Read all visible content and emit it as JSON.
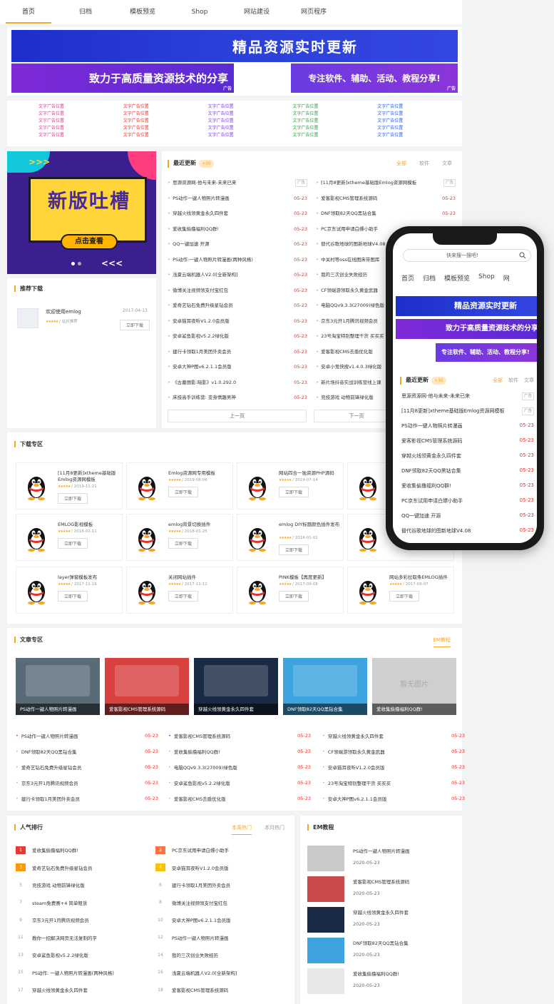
{
  "nav": [
    "首页",
    "归档",
    "模板预览",
    "Shop",
    "网站建设",
    "网页程序"
  ],
  "banners": {
    "b1": "精品资源实时更新",
    "b2": "致力于高质量资源技术的分享",
    "b3": "专注软件、辅助、活动、教程分享!",
    "ad_tag": "广告"
  },
  "text_ads": {
    "label": "文字广告位置",
    "colors": [
      "#e0358f",
      "#e5322d",
      "#7b3fd6",
      "#2ea043",
      "#2b5bd7"
    ]
  },
  "promo": {
    "title": "新版吐槽",
    "cta": "点击查看",
    "arrows_top": ">>>",
    "arrows_bottom": "<<<"
  },
  "recommend": {
    "title": "推荐下载",
    "item": {
      "name": "欢迎使用emlog",
      "date": "2017-04-13",
      "stars": "★★★★★",
      "meta": "/ 站长推荐",
      "button": "立即下载"
    }
  },
  "latest": {
    "title": "最近更新",
    "badge": "+30",
    "tabs": [
      "全部",
      "软件",
      "文章"
    ],
    "left": [
      {
        "t": "思源资源网-他与未来-未来已来",
        "d": "广告",
        "ad": true
      },
      {
        "t": "PS动作一键人物照片转漫画",
        "d": "05-23"
      },
      {
        "t": "穿越火线领黄金永久四件套",
        "d": "05-23"
      },
      {
        "t": "爱收集偷撸福利QQ群!",
        "d": "05-23"
      },
      {
        "t": "QQ一键加速 开源",
        "d": "05-23"
      },
      {
        "t": "PS动作:一键人物照片转漫画(两种风格)",
        "d": "05-23"
      },
      {
        "t": "浅夏云端机器人V2.0[全新架构]",
        "d": "05-23"
      },
      {
        "t": "微博关注视频领支付宝红包",
        "d": "05-23"
      },
      {
        "t": "爱奇艺钻石免费升级星钻会员",
        "d": "05-23"
      },
      {
        "t": "安卓猫耳夜听V1.2.0会员版",
        "d": "05-23"
      },
      {
        "t": "安卓鲨鱼影视v5.2.2绿化版",
        "d": "05-23"
      },
      {
        "t": "建行卡领取1月美团外卖会员",
        "d": "05-23"
      },
      {
        "t": "安卓大神P图v6.2.1.1会员版",
        "d": "05-23"
      },
      {
        "t": "《古墓丽影:暗影》v1.0.292.0",
        "d": "05-23"
      },
      {
        "t": "床技高手训练营: 变身情趣男神",
        "d": "05-23"
      }
    ],
    "right": [
      {
        "t": "[11月8更新]xtheme基础版Emlog资源网模板",
        "d": "广告",
        "ad": true
      },
      {
        "t": "爱客影视CMS管理系统源码",
        "d": "05-23"
      },
      {
        "t": "DNF领取82天QQ黑钻合集",
        "d": "05-23"
      },
      {
        "t": "PC京东试用申请白嫖小助手",
        "d": "05-23"
      },
      {
        "t": "替代谷歌地球的图新地球V4.08",
        "d": "05-23"
      },
      {
        "t": "中关村等oss在线图床带图库",
        "d": "05-23"
      },
      {
        "t": "我的三次创业失败经历",
        "d": "05-23"
      },
      {
        "t": "CF领端游领取永久黄金武器",
        "d": "05-23"
      },
      {
        "t": "电脑QQv9.3.3(27009)绿色版",
        "d": "05-23"
      },
      {
        "t": "京东3元开1月腾讯视频会员",
        "d": "05-23"
      },
      {
        "t": "23号淘宝特别整理干货 买买买",
        "d": "05-23"
      },
      {
        "t": "爱客影视CMS去盾优化版",
        "d": "05-23"
      },
      {
        "t": "安卓小鬼快搜v1.4.0.3绿化版",
        "d": "05-23"
      },
      {
        "t": "新片场抖音实战训练营线上课",
        "d": "05-23"
      },
      {
        "t": "竞技游戏 动物前锋绿化版",
        "d": "05-23"
      }
    ],
    "prev": "上一页",
    "next": "下一页"
  },
  "downloads": {
    "title": "下载专区",
    "items": [
      {
        "name": "[11月8更新]xtheme基础版Emlog资源网模板",
        "meta": "/ 2019-11-21",
        "stars": "★★★★★"
      },
      {
        "name": "Emlog资源网专用模板",
        "meta": "/ 2019-08-06",
        "stars": "★★★★★"
      },
      {
        "name": "网站四合一独资源PHP源码",
        "meta": "/ 2019-07-14",
        "stars": "★★★★★"
      },
      {
        "name": "",
        "meta": "",
        "stars": ""
      },
      {
        "name": "EMLOG影视模板",
        "meta": "/ 2018-02-11",
        "stars": "★★★★★"
      },
      {
        "name": "emlog背景切换插件",
        "meta": "/ 2018-01-25",
        "stars": "★★★★★"
      },
      {
        "name": "emlog DIY标题颜色插件发布",
        "meta": "/ 2018-01-01",
        "stars": "★★★★★"
      },
      {
        "name": "",
        "meta": "",
        "stars": ""
      },
      {
        "name": "layer弹窗模板发布",
        "meta": "/ 2017-11-16",
        "stars": "★★★★★"
      },
      {
        "name": "关闭网站插件",
        "meta": "/ 2017-11-12",
        "stars": "★★★★★"
      },
      {
        "name": "PINK模板【再度更新】",
        "meta": "/ 2017-09-08",
        "stars": "★★★★★"
      },
      {
        "name": "网站多彩拉取条EMLOG插件",
        "meta": "/ 2017-09-07",
        "stars": "★★★★★"
      }
    ],
    "button": "立即下载"
  },
  "articles": {
    "title": "文章专区",
    "tab": "EM教程",
    "thumbs": [
      {
        "cap": "PS动作一键人物照片转漫画",
        "color": "#5a6b78"
      },
      {
        "cap": "爱客影视CMS管理系统源码",
        "color": "#d94141"
      },
      {
        "cap": "穿越火线领黄金永久四件套",
        "color": "#1b2a44"
      },
      {
        "cap": "DNF领取82天QQ黑钻合集",
        "color": "#3da4e0"
      },
      {
        "cap": "爱收集偷撸福利QQ群!",
        "color": "#cfcfcf"
      }
    ],
    "placeholder": "暂无图片",
    "lists": [
      [
        {
          "t": "PS动作一键人物照片转漫画",
          "d": "05-23"
        },
        {
          "t": "DNF领取82天QQ黑钻合集",
          "d": "05-23"
        },
        {
          "t": "爱奇艺钻石免费升级星钻会员",
          "d": "05-23"
        },
        {
          "t": "京东3元开1月腾讯视频会员",
          "d": "05-23"
        },
        {
          "t": "建行卡领取1月美团外卖会员",
          "d": "05-23"
        }
      ],
      [
        {
          "t": "爱客影视CMS管理系统源码",
          "d": "05-23"
        },
        {
          "t": "爱收集偷撸福利QQ群!",
          "d": "05-23"
        },
        {
          "t": "电脑QQv9.3.3(27009)绿色版",
          "d": "05-23"
        },
        {
          "t": "安卓鲨鱼影视v5.2.2绿化版",
          "d": "05-23"
        },
        {
          "t": "爱客影视CMS去盾优化版",
          "d": "05-23"
        }
      ],
      [
        {
          "t": "穿越火线领黄金永久四件套",
          "d": "05-23"
        },
        {
          "t": "CF领端游领取永久黄金武器",
          "d": "05-23"
        },
        {
          "t": "安卓猫耳夜听V1.2.0会员版",
          "d": "05-23"
        },
        {
          "t": "23号淘宝特别整理干货 买买买",
          "d": "05-23"
        },
        {
          "t": "安卓大神P图v6.2.1.1会员版",
          "d": "05-23"
        }
      ]
    ]
  },
  "hot": {
    "title": "人气排行",
    "tabs": [
      "本周热门",
      "本月热门"
    ],
    "items": [
      "爱收集偷撸福利QQ群!",
      "PC京东试用申请白嫖小助手",
      "爱奇艺钻石免费升级星钻会员",
      "安卓猫耳夜听V1.2.0会员版",
      "竞技游戏 动物前锋绿化版",
      "建行卡领取1月美团外卖会员",
      "steam免费赛+4 简单租赁",
      "微博关注视频领支付宝红包",
      "京东3元开1月腾讯视频会员",
      "安卓大神P图v6.2.1.1会员版",
      "教你一招解决网页无法复制的字",
      "PS动作一键人物照片转漫画",
      "安卓鲨鱼影视v5.2.2绿化版",
      "我的三次创业失败经历",
      "PS动作: 一键人物照片转漫画(两种风格)",
      "浅夏云端机器人V2.0[全新架构]",
      "穿越火线领黄金永久四件套",
      "爱客影视CMS管理系统源码"
    ]
  },
  "em": {
    "title": "EM教程",
    "items": [
      {
        "t": "PS动作一键人物照片转漫画",
        "d": "2020-05-23",
        "color": "#c9c9c9"
      },
      {
        "t": "爱客影视CMS管理系统源码",
        "d": "2020-05-23",
        "color": "#c84a4a"
      },
      {
        "t": "穿越火线领黄金永久四件套",
        "d": "2020-05-23",
        "color": "#1b2a44"
      },
      {
        "t": "DNF领取82天QQ黑钻合集",
        "d": "2020-05-23",
        "color": "#3da4e0"
      },
      {
        "t": "爱收集偷撸福利QQ群!",
        "d": "2020-05-23",
        "color": "#e8e8e8"
      }
    ]
  },
  "phone": {
    "search_placeholder": "快来搜一搜吧!",
    "nav": [
      "首页",
      "归档",
      "模板预览",
      "Shop",
      "网"
    ],
    "b1": "精品资源实时更新",
    "b2": "致力于高质量资源技术的分享",
    "b3": "专注软件、辅助、活动、教程分享!",
    "latest_title": "最近更新",
    "badge": "+30",
    "tabs": [
      "全部",
      "软件",
      "文章"
    ],
    "items": [
      {
        "t": "思源资源网-他与未来-未来已来",
        "d": "广告",
        "ad": true
      },
      {
        "t": "[11月8更新]xtheme基础版Emlog资源网模板",
        "d": "广告",
        "ad": true
      },
      {
        "t": "PS动作一键人物照片转漫画",
        "d": "05-23"
      },
      {
        "t": "爱客影视CMS管理系统源码",
        "d": "05-23"
      },
      {
        "t": "穿越火线领黄金永久四件套",
        "d": "05-23"
      },
      {
        "t": "DNF领取82天QQ黑钻合集",
        "d": "05-23"
      },
      {
        "t": "爱收集偷撸福利QQ群!",
        "d": "05-23"
      },
      {
        "t": "PC京东试用申请白嫖小助手",
        "d": "05-23"
      },
      {
        "t": "QQ一键加速 开源",
        "d": "05-23"
      },
      {
        "t": "替代谷歌地球的图新地球V4.08",
        "d": "05-23"
      }
    ]
  }
}
